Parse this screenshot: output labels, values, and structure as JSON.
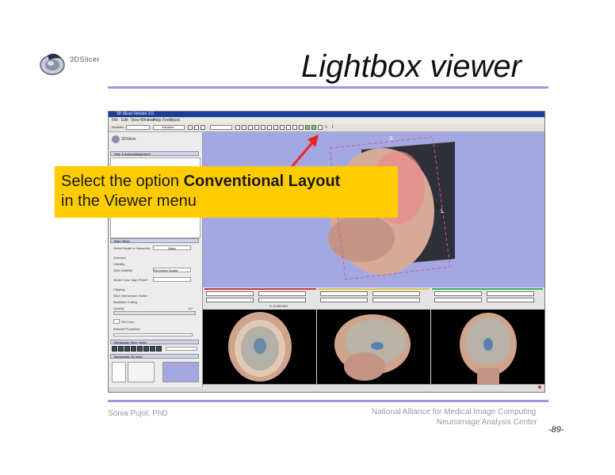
{
  "slide": {
    "title": "Lightbox viewer",
    "logo_text": "3DSlicer",
    "callout": {
      "line1_prefix": "Select the option ",
      "line1_bold": "Conventional Layout",
      "line2": "in the Viewer menu"
    },
    "author": "Sonia Pujol, PhD",
    "org_line1": "National Alliance for Medical Image Computing",
    "org_line2": "Neuroimage Analysis Center",
    "page_number": "-89-",
    "accent_color": "#9999dd",
    "callout_color": "#ffcc00",
    "arrow_color": "#e8261c"
  },
  "screenshot": {
    "window_title": "3D Slicer Version 3.0",
    "menu": [
      "File",
      "Edit",
      "View",
      "Window",
      "Help",
      "Feedback"
    ],
    "toolbar": {
      "module_label": "Modules:",
      "module_value": "Volumes"
    },
    "panel": {
      "logo_text": "3DSlicer",
      "help_section": "Help & Acknowledgement",
      "main_section": "Main Slicer",
      "select_label": "Select Model or Hierarchy:",
      "select_value": "Brain",
      "rows": [
        "Selected",
        "Visibility",
        "Slice Visibility",
        "Model Color Map Preset",
        "Clipping",
        "Slice Intersection Visible",
        "Backface Culling",
        "Opacity"
      ],
      "scalar_display": "Set Active Scalar",
      "opacity_value": "1.0",
      "set_color": "Set Color",
      "material_props": "Material Properties",
      "manipulate_slice_views": "Manipulate Slice Views",
      "manipulate_3d_view": "Manipulate 3D View"
    },
    "view3d": {
      "label_s": "S",
      "label_l": "L"
    },
    "strip": {
      "offset_label": "S: 0.000 MM"
    }
  }
}
